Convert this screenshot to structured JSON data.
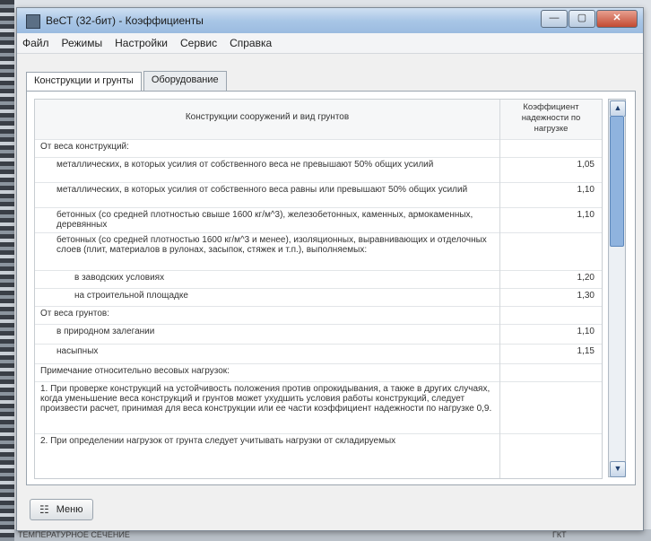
{
  "window": {
    "title": "ВеСТ (32-бит) - Коэффициенты",
    "controls": [
      "—",
      "▢",
      "✕"
    ]
  },
  "menubar": [
    "Файл",
    "Режимы",
    "Настройки",
    "Сервис",
    "Справка"
  ],
  "tabs": [
    {
      "label": "Конструкции и грунты",
      "active": true
    },
    {
      "label": "Оборудование",
      "active": false
    }
  ],
  "table": {
    "columns": [
      "Конструкции сооружений и вид грунтов",
      "Коэффициент надежности по нагрузке"
    ],
    "rows": [
      {
        "text": "От веса конструкций:",
        "value": ""
      },
      {
        "text": "металлических, в которых усилия от собственного веса не превышают 50% общих усилий",
        "value": "1,05"
      },
      {
        "text": "металлических, в которых усилия от собственного веса равны или превышают 50% общих усилий",
        "value": "1,10"
      },
      {
        "text": "бетонных (со средней плотностью свыше 1600 кг/м^3), железобетонных, каменных, армокаменных, деревянных",
        "value": "1,10"
      },
      {
        "text": "бетонных (со средней плотностью 1600 кг/м^3 и менее), изоляционных, выравнивающих и отделочных слоев (плит, материалов в рулонах, засыпок, стяжек и т.п.), выполняемых:",
        "value": ""
      },
      {
        "text": "в заводских условиях",
        "value": "1,20"
      },
      {
        "text": "на строительной площадке",
        "value": "1,30"
      },
      {
        "text": "От веса грунтов:",
        "value": ""
      },
      {
        "text": "в природном залегании",
        "value": "1,10"
      },
      {
        "text": "насыпных",
        "value": "1,15"
      },
      {
        "text": "Примечание относительно весовых нагрузок:",
        "value": ""
      },
      {
        "text": "1. При проверке конструкций на устойчивость положения против опрокидывания, а также в других случаях, когда уменьшение веса конструкций и грунтов может ухудшить условия работы конструкций, следует произвести расчет, принимая для веса конструкции или ее части коэффициент надежности по нагрузке 0,9.",
        "value": ""
      },
      {
        "text": "2. При определении нагрузок от грунта следует учитывать нагрузки от складируемых",
        "value": ""
      }
    ]
  },
  "footer": {
    "menu_label": "Меню"
  },
  "background": {
    "status_text_left": "ТЕМПЕРАТУРНОЕ СЕЧЕНИЕ",
    "status_text_right": "ГКТ"
  },
  "icons": {
    "app": "app-icon",
    "menu": "menu-icon",
    "scroll_up": "scroll-up-icon",
    "scroll_down": "scroll-down-icon"
  }
}
